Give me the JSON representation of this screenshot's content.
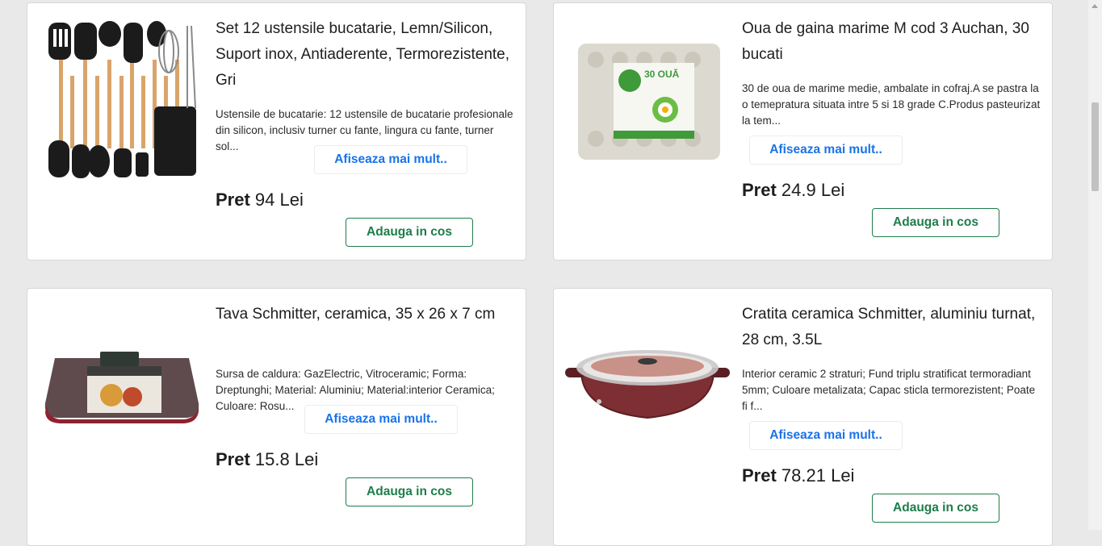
{
  "products": [
    {
      "title": "Set 12 ustensile bucatarie, Lemn/Silicon, Suport inox, Antiaderente, Termorezistente, Gri",
      "description": "Ustensile de bucatarie: 12 ustensile de bucatarie profesionale din silicon, inclusiv turner cu fante, lingura cu fante, turner sol...",
      "more_label": "Afiseaza mai mult..",
      "price_label": "Pret",
      "price_value": "94 Lei",
      "add_label": "Adauga in cos",
      "image_icon": "kitchen-utensils-set-image"
    },
    {
      "title": "Oua de gaina marime M cod 3 Auchan, 30 bucati",
      "description": "30 de oua de marime medie, ambalate in cofraj.A se pastra la o temepratura situata intre 5 si 18 grade C.Produs pasteurizat la tem...",
      "more_label": "Afiseaza mai mult..",
      "price_label": "Pret",
      "price_value": "24.9 Lei",
      "add_label": "Adauga in cos",
      "image_icon": "egg-carton-image",
      "package_label": "30 OUĂ"
    },
    {
      "title": "Tava Schmitter, ceramica, 35 x 26 x 7 cm",
      "description": "Sursa de caldura: GazElectric, Vitroceramic; Forma: Dreptunghi; Material: Aluminiu; Material:interior Ceramica; Culoare: Rosu...",
      "more_label": "Afiseaza mai mult..",
      "price_label": "Pret",
      "price_value": "15.8 Lei",
      "add_label": "Adauga in cos",
      "image_icon": "baking-tray-image"
    },
    {
      "title": "Cratita ceramica Schmitter, aluminiu turnat, 28 cm, 3.5L",
      "description": "Interior ceramic 2 straturi; Fund triplu stratificat termoradiant 5mm; Culoare metalizata; Capac sticla termorezistent; Poate fi f...",
      "more_label": "Afiseaza mai mult..",
      "price_label": "Pret",
      "price_value": "78.21 Lei",
      "add_label": "Adauga in cos",
      "image_icon": "ceramic-pot-image"
    }
  ]
}
